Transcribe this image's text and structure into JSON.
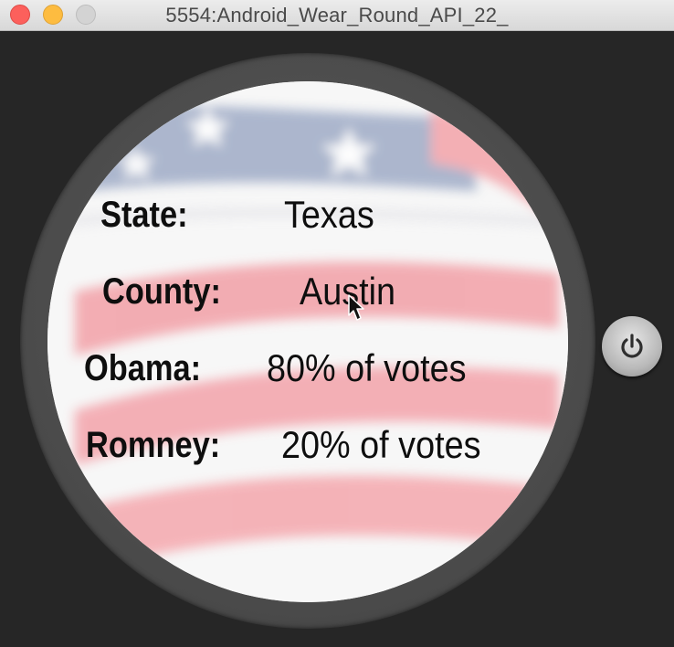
{
  "window": {
    "title": "5554:Android_Wear_Round_API_22_"
  },
  "icons": {
    "close": "close-dot",
    "minimize": "minimize-dot",
    "zoom": "zoom-dot",
    "power": "power-icon",
    "cursor": "mouse-pointer-icon"
  },
  "colors": {
    "background": "#262626",
    "bezel": "#4a4a4a",
    "flag_red": "#f08d95",
    "flag_blue": "#9aa7c2",
    "text": "#0e0e0e"
  },
  "watch": {
    "rows": [
      {
        "label": "State:",
        "value": "Texas"
      },
      {
        "label": "County:",
        "value": "Austin"
      },
      {
        "label": "Obama:",
        "value": "80%  of votes"
      },
      {
        "label": "Romney:",
        "value": "20% of votes"
      }
    ]
  }
}
